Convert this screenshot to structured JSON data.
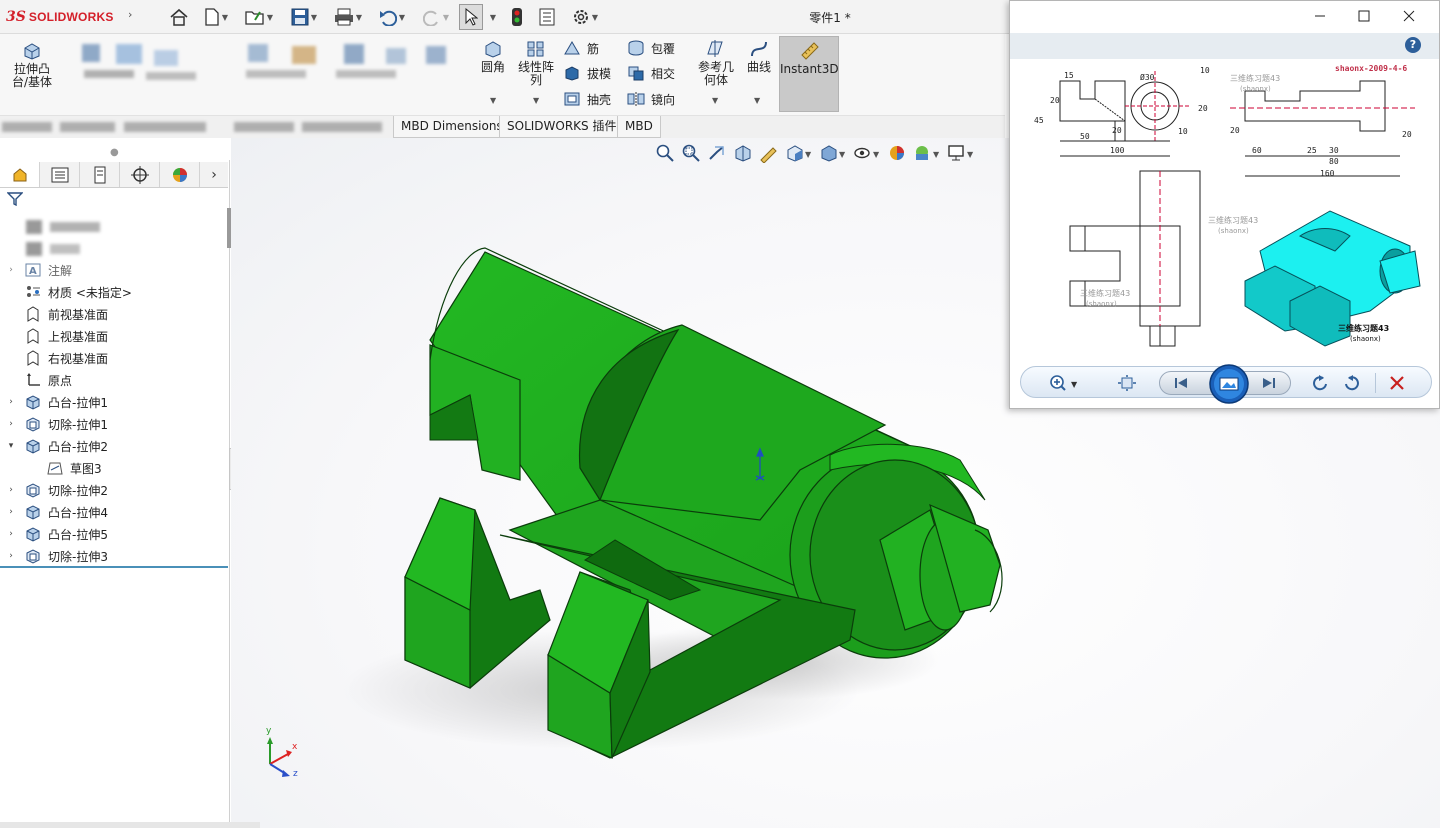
{
  "app": {
    "logo_ds": "3S",
    "logo_text": "SOLIDWORKS",
    "document_title": "零件1 *"
  },
  "quick_access": {
    "icons": [
      "home-icon",
      "new-file-icon",
      "open-file-icon",
      "save-icon",
      "print-icon",
      "undo-icon",
      "redo-icon",
      "select-icon",
      "rebuild-icon",
      "file-properties-icon",
      "options-icon"
    ]
  },
  "command_manager": {
    "extrude_boss": "拉伸凸\n台/基体",
    "fillet": "圆角",
    "linear_pattern": "线性阵\n列",
    "rib": "筋",
    "draft": "拔模",
    "shell": "抽壳",
    "wrap": "包覆",
    "intersect": "相交",
    "mirror": "镜向",
    "reference_geometry": "参考几\n何体",
    "curves": "曲线",
    "instant3d": "Instant3D"
  },
  "tabs": [
    {
      "label": "MBD Dimensions"
    },
    {
      "label": "SOLIDWORKS 插件"
    },
    {
      "label": "MBD"
    }
  ],
  "feature_tree": {
    "items": [
      {
        "label": "注解",
        "icon": "annotations-icon",
        "expandable": true,
        "expanded": false
      },
      {
        "label": "材质 <未指定>",
        "icon": "material-icon",
        "expandable": false
      },
      {
        "label": "前视基准面",
        "icon": "plane-icon",
        "expandable": false
      },
      {
        "label": "上视基准面",
        "icon": "plane-icon",
        "expandable": false
      },
      {
        "label": "右视基准面",
        "icon": "plane-icon",
        "expandable": false
      },
      {
        "label": "原点",
        "icon": "origin-icon",
        "expandable": false
      },
      {
        "label": "凸台-拉伸1",
        "icon": "boss-extrude-icon",
        "expandable": true,
        "expanded": false
      },
      {
        "label": "切除-拉伸1",
        "icon": "cut-extrude-icon",
        "expandable": true,
        "expanded": false
      },
      {
        "label": "凸台-拉伸2",
        "icon": "boss-extrude-icon",
        "expandable": true,
        "expanded": true
      },
      {
        "label": "草图3",
        "icon": "sketch-icon",
        "expandable": false,
        "child": true
      },
      {
        "label": "切除-拉伸2",
        "icon": "cut-extrude-icon",
        "expandable": true,
        "expanded": false
      },
      {
        "label": "凸台-拉伸4",
        "icon": "boss-extrude-icon",
        "expandable": true,
        "expanded": false
      },
      {
        "label": "凸台-拉伸5",
        "icon": "boss-extrude-icon",
        "expandable": true,
        "expanded": false
      },
      {
        "label": "切除-拉伸3",
        "icon": "cut-extrude-icon",
        "expandable": true,
        "expanded": false
      }
    ]
  },
  "triad": {
    "x": "x",
    "y": "y",
    "z": "z"
  },
  "colors": {
    "model_green": "#1fa51f",
    "model_green_dark": "#137a13",
    "viewer_cyan": "#1cf0f0",
    "brand_red": "#d4202a"
  },
  "viewer": {
    "window_controls": [
      "minimize-icon",
      "maximize-icon",
      "close-icon"
    ],
    "drawing": {
      "stamp": "shaonx-2009-4-6",
      "title": "三维练习题43",
      "subtitle": "(shaonx)",
      "dims": {
        "d15": "15",
        "d20a": "20",
        "d45": "45",
        "d50": "50",
        "d100": "100",
        "d20b": "20",
        "dia30": "Ø30",
        "r10": "10",
        "d10": "10",
        "d20c": "20",
        "d20d": "20",
        "d20e": "20",
        "d60": "60",
        "d25": "25",
        "d30": "30",
        "d80": "80",
        "d160": "160"
      }
    },
    "toolbar": [
      "zoom-icon",
      "fit-icon",
      "previous-icon",
      "slideshow-icon",
      "next-icon",
      "rotate-ccw-icon",
      "rotate-cw-icon",
      "delete-icon"
    ]
  }
}
